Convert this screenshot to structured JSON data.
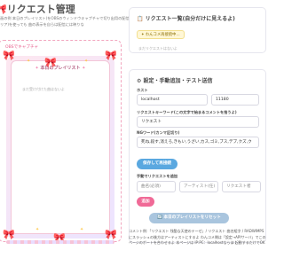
{
  "header": {
    "title": "リクエスト管理",
    "description": "画の例 本日のプレイリスト(をOBSのウィンドウキャプチャで切り出用の配信エリア)を使っても 曲の表示を自らは配信には映りな"
  },
  "preview": {
    "capture_label": "OBSでキャプチャ",
    "playlist_title": "本日のプレイリスト",
    "empty_text": "まだ受け付けた曲はないよ"
  },
  "requests_panel": {
    "title": "リクエスト一覧(自分だけに見えるよ)",
    "badge": "わんコメ再接続中…",
    "empty_text": "まだリクエストはないよ"
  },
  "settings_panel": {
    "title": "設定・手動追加・テスト送信",
    "host_label": "ホスト",
    "host_value": "localhost",
    "port_value": "11180",
    "keyword_label": "リクエストキーワード(この文字で始まるコメントを拾うよ)",
    "keyword_value": "リクエスト",
    "ngword_label": "NGワード(カンマ区切り)",
    "ngword_value": "死ね,殺す,消えろ,きもい,うざい,カス,ゴミ,ブス,デブ,クズ,ク",
    "save_button": "保存して再接続",
    "manual_label": "手動でリクエストを追加",
    "song_placeholder": "曲名(必須)",
    "artist_placeholder": "アーティスト(任)",
    "requester_placeholder": "リクエスト者",
    "add_button": "追加",
    "reset_button": "本日のプレイリストをリセット"
  },
  "footer_note": "コメント例:「リクエスト 残酷な天使のテーゼ」/ リクエスト 曲名組字 / RADWIMPSにスラッシュの後方はアーティストにするよ わんコメ側は「設定→APIサーバ」でこのページのポートを合わせるよ 本ページは IP:PC：localhostならほ 起動するだけでOK"
}
